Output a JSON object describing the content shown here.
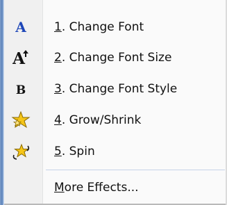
{
  "menu": {
    "items": [
      {
        "icon": "font-a-icon",
        "accel": "1",
        "rest": ". Change Font"
      },
      {
        "icon": "font-size-icon",
        "accel": "2",
        "rest": ". Change Font Size"
      },
      {
        "icon": "font-style-bold-icon",
        "accel": "3",
        "rest": ". Change Font Style"
      },
      {
        "icon": "grow-shrink-star-icon",
        "accel": "4",
        "rest": ". Grow/Shrink"
      },
      {
        "icon": "spin-star-icon",
        "accel": "5",
        "rest": ". Spin"
      }
    ],
    "more_effects": {
      "accel": "M",
      "rest": "ore Effects..."
    }
  }
}
